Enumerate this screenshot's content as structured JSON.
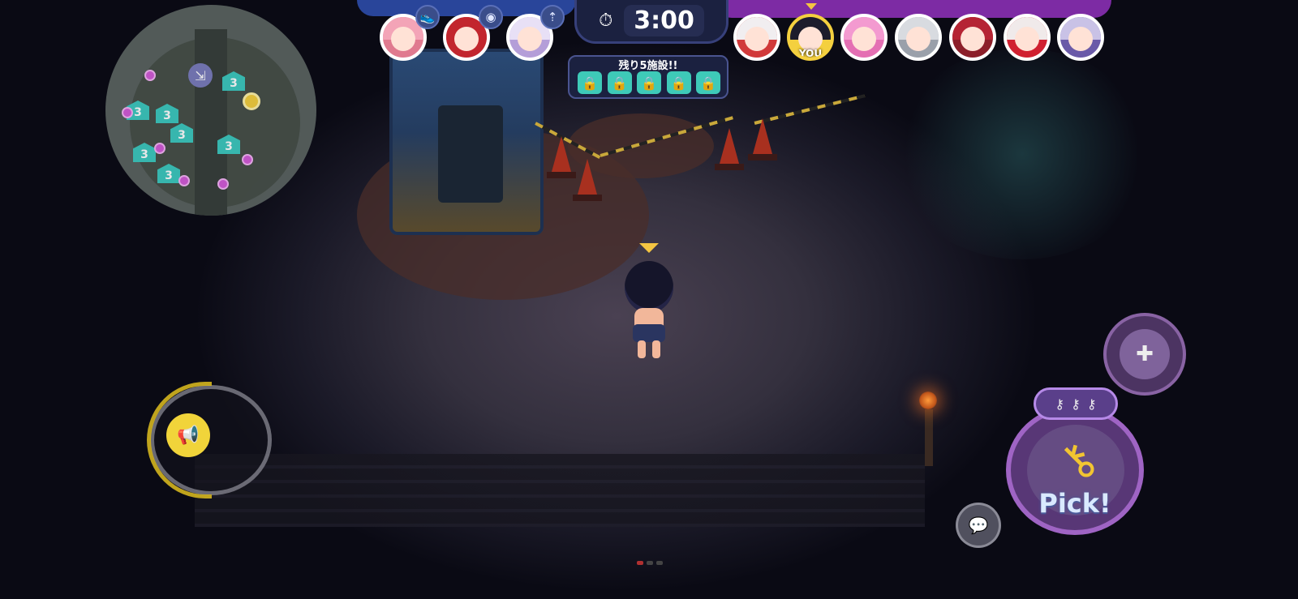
{
  "hud": {
    "timer": {
      "icon": "stopwatch-icon",
      "value": "3:00"
    },
    "facilities": {
      "label": "残り5施設!!",
      "locks": [
        "lock-icon",
        "lock-icon",
        "lock-icon",
        "lock-icon",
        "lock-icon"
      ]
    },
    "team_left": {
      "color": "#2c4ba8",
      "players": [
        {
          "name": "player-1"
        },
        {
          "name": "player-2"
        },
        {
          "name": "player-3"
        }
      ],
      "status_icons": [
        "running-shoe-icon",
        "broadcast-icon",
        "person-up-icon"
      ]
    },
    "team_right": {
      "color": "#8a2fb4",
      "players": [
        {
          "name": "player-4"
        },
        {
          "name": "player-you",
          "you_label": "YOU"
        },
        {
          "name": "player-6"
        },
        {
          "name": "player-7"
        },
        {
          "name": "player-8"
        },
        {
          "name": "player-9"
        },
        {
          "name": "player-10"
        }
      ]
    }
  },
  "minimap": {
    "facility_level": "3",
    "exit_icon": "exit-door-icon"
  },
  "controls": {
    "pick_button_label": "Pick!",
    "pick_icon": "key-icon",
    "keys_icon": "key-icon",
    "item_icon": "medkit-icon",
    "chat_icon": "chat-bubble-icon",
    "joystick_icon": "horn-icon"
  },
  "colors": {
    "accent_yellow": "#f4c542",
    "facility_teal": "#3cc9bf",
    "enemy_pink": "#d35cd9"
  }
}
